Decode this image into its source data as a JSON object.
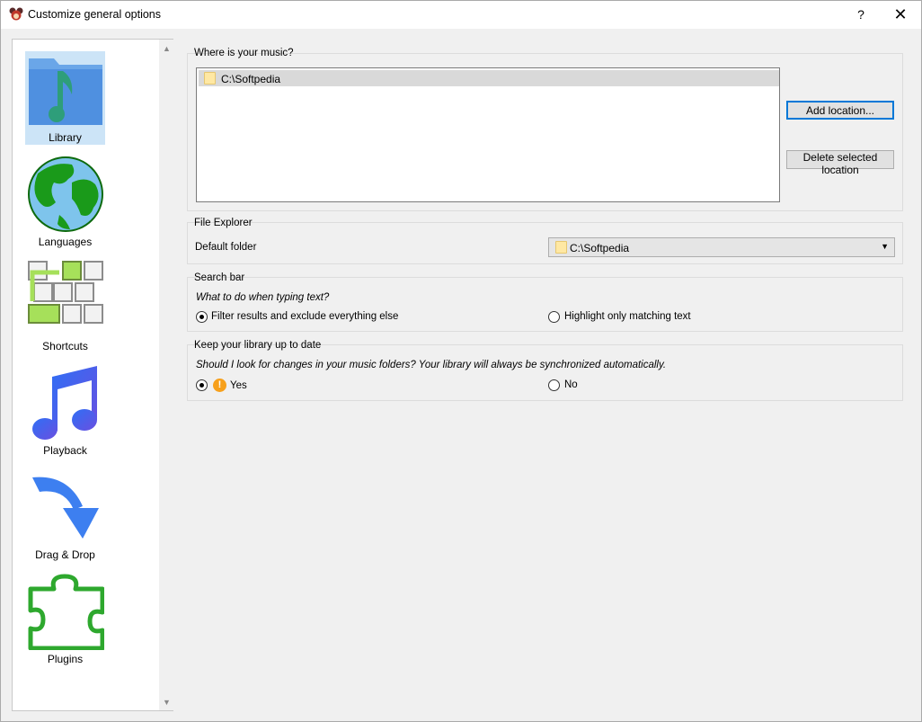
{
  "window": {
    "title": "Customize general options",
    "help": "?",
    "close": "✕"
  },
  "sidebar": {
    "items": [
      {
        "label": "Library",
        "icon": "folder-music-icon",
        "selected": true
      },
      {
        "label": "Languages",
        "icon": "globe-icon"
      },
      {
        "label": "Shortcuts",
        "icon": "keyboard-shortcuts-icon"
      },
      {
        "label": "Playback",
        "icon": "music-note-icon"
      },
      {
        "label": "Drag & Drop",
        "icon": "drag-arrow-icon"
      },
      {
        "label": "Plugins",
        "icon": "puzzle-piece-icon"
      }
    ]
  },
  "music": {
    "group_label": "Where is your music?",
    "locations": [
      "C:\\Softpedia"
    ],
    "add_button": "Add location...",
    "delete_button": "Delete selected location"
  },
  "file_explorer": {
    "group_label": "File Explorer",
    "default_folder_label": "Default folder",
    "default_folder_value": "C:\\Softpedia"
  },
  "search_bar": {
    "group_label": "Search bar",
    "question": "What to do when typing text?",
    "option_filter": "Filter results and exclude everything else",
    "option_highlight": "Highlight only matching text"
  },
  "library_sync": {
    "group_label": "Keep your library up to date",
    "question": "Should I look for changes in your music folders? Your library will always be synchronized automatically.",
    "option_yes": "Yes",
    "option_no": "No"
  },
  "colors": {
    "accent": "#0078d7",
    "selection": "#cce4f7",
    "warning": "#f7a01b"
  }
}
